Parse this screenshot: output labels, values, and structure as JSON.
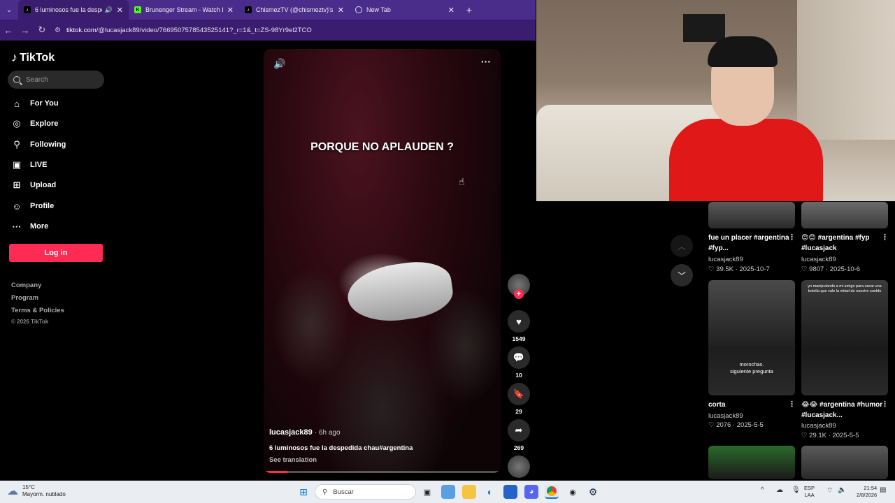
{
  "browser": {
    "tabs": [
      {
        "title": "6 luminosos fue la despedi",
        "favicon": "tiktok-icon",
        "active": true,
        "audio": true
      },
      {
        "title": "Brunenger Stream - Watch Live",
        "favicon": "kick-icon",
        "active": false
      },
      {
        "title": "ChismezTV (@chismeztv)'s vide",
        "favicon": "tiktok-icon",
        "active": false
      },
      {
        "title": "New Tab",
        "favicon": "chrome-icon",
        "active": false
      }
    ],
    "url_domain": "tiktok.com",
    "url_path": "/@lucasjack89/video/7669507578543525141?_r=1&_t=ZS-98Yr9el2TCO",
    "accent_color": "#4a2d8a"
  },
  "tiktok": {
    "logo_text": "TikTok",
    "search_placeholder": "Search",
    "nav": [
      {
        "label": "For You",
        "icon": "home-icon"
      },
      {
        "label": "Explore",
        "icon": "compass-icon"
      },
      {
        "label": "Following",
        "icon": "following-icon"
      },
      {
        "label": "LIVE",
        "icon": "live-icon"
      },
      {
        "label": "Upload",
        "icon": "upload-icon"
      },
      {
        "label": "Profile",
        "icon": "profile-icon"
      },
      {
        "label": "More",
        "icon": "more-icon"
      }
    ],
    "login_label": "Log in",
    "footer": {
      "company": "Company",
      "program": "Program",
      "terms": "Terms & Policies",
      "copyright": "© 2026 TikTok"
    },
    "brand_color": "#fe2c55"
  },
  "video": {
    "overlay_caption": "PORQUE NO APLAUDEN ?",
    "author": "lucasjack89",
    "time_ago": "· 6h ago",
    "description": "6 luminosos fue la despedida chau#argentina",
    "translate_label": "See translation",
    "progress": 0.1,
    "likes": "1549",
    "comments": "10",
    "saves": "29",
    "shares": "269"
  },
  "related": [
    {
      "title": "fue un placer #argentina #fyp...",
      "author": "lucasjack89",
      "likes": "39.5K",
      "date": "2025-10-7"
    },
    {
      "title": "😊😊 #argentina #fyp #lucasjack",
      "author": "lucasjack89",
      "likes": "9807",
      "date": "2025-10-6"
    },
    {
      "title": "corta",
      "author": "lucasjack89",
      "likes": "2076",
      "date": "2025-5-5",
      "thumb_text": "morochas.\nsiguiente pregunta"
    },
    {
      "title": "😂😂 #argentina #humor #lucasjack...",
      "author": "lucasjack89",
      "likes": "29.1K",
      "date": "2025-5-5",
      "thumb_text": "yo manipulando a mi amigo para sacar una botella que vale la mitad de nuestro sueldo"
    }
  ],
  "taskbar": {
    "weather_temp": "15°C",
    "weather_desc": "Mayorm. nublado",
    "search_placeholder": "Buscar",
    "lang_top": "ESP",
    "lang_bottom": "LAA",
    "time": "21:54",
    "date": "2/8/2026"
  }
}
